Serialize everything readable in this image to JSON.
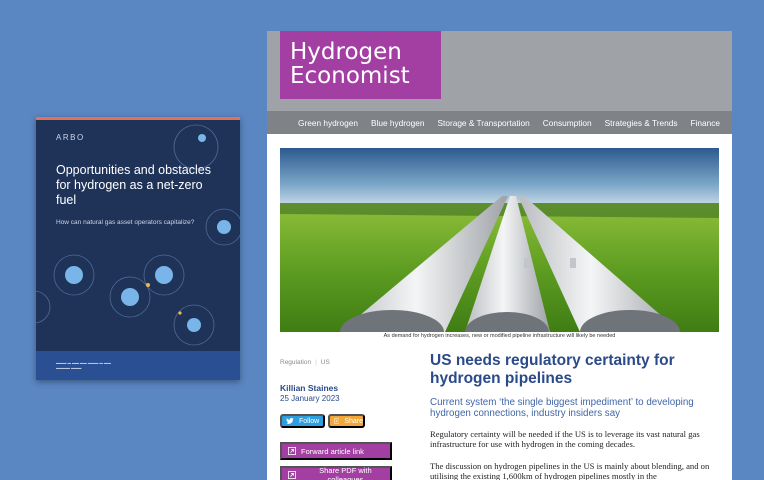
{
  "report": {
    "brand": "ARBO",
    "title": "Opportunities and obstacles for hydrogen as a net-zero fuel",
    "subtitle": "How can natural gas asset operators capitalize?",
    "colors": {
      "background": "#1f3359",
      "footer": "#2a4f93",
      "accent": "#e46f5c",
      "circle": "#79b5e8"
    }
  },
  "site": {
    "logo_lines": [
      "Hydrogen",
      "Economist"
    ],
    "nav": [
      "Green hydrogen",
      "Blue hydrogen",
      "Storage & Transportation",
      "Consumption",
      "Strategies & Trends",
      "Finance"
    ],
    "hero_caption": "As demand for hydrogen increases, new or modified pipeline infrastructure will likely be needed",
    "meta": {
      "category": "Regulation",
      "region": "US"
    },
    "author": "Killian Staines",
    "date": "25 January 2023",
    "buttons": {
      "follow": "Follow",
      "share": "Share",
      "forward": "Forward article link",
      "pdf": "Share PDF with colleagues"
    },
    "article": {
      "headline": "US needs regulatory certainty for hydrogen pipelines",
      "standfirst": "Current system ‘the single biggest impediment’ to developing hydrogen connections, industry insiders say",
      "paragraphs": [
        "Regulatory certainty will be needed if the US is to leverage its vast natural gas infrastructure for use with hydrogen in the coming decades.",
        "The discussion on hydrogen pipelines in the US is mainly about blending, and on utilising the existing 1,600km of hydrogen pipelines mostly in the"
      ]
    },
    "colors": {
      "logo": "#a33fa3",
      "header": "#9fa2a6",
      "nav": "#7f8388",
      "headline": "#2a4a8a",
      "follow": "#2d9ee0",
      "share": "#f2a738"
    }
  }
}
